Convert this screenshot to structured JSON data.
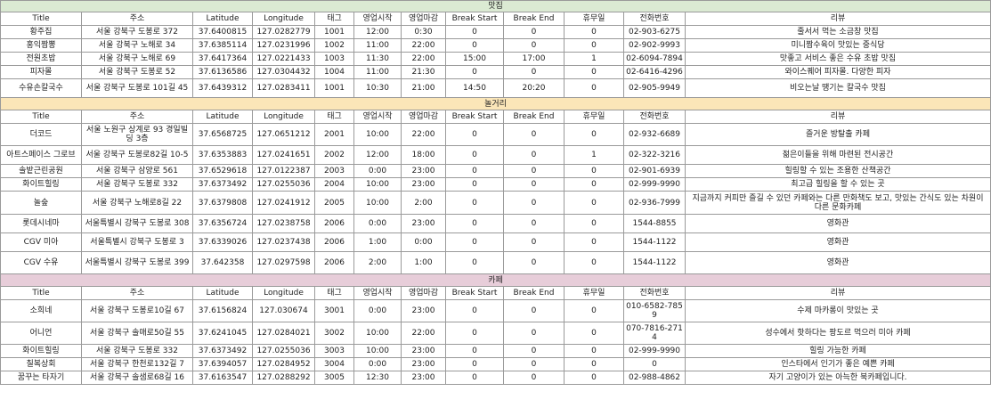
{
  "colors": {
    "section1_bg": "#dbead3",
    "section2_bg": "#fbe6b8",
    "section3_bg": "#e7cdd9",
    "grid": "#9a9a9a"
  },
  "headers": [
    "Title",
    "주소",
    "Latitude",
    "Longitude",
    "태그",
    "영업시작",
    "영업마감",
    "Break Start",
    "Break End",
    "휴무일",
    "전화번호",
    "리뷰"
  ],
  "sections": [
    {
      "title": "맛집",
      "rows": [
        [
          "황주집",
          "서울 강북구 도봉로 372",
          "37.6400815",
          "127.0282779",
          "1001",
          "12:00",
          "0:30",
          "0",
          "0",
          "0",
          "02-903-6275",
          "줄서서 먹는 소금창 맛집"
        ],
        [
          "홍익짬뽕",
          "서울 강북구 노해로 34",
          "37.6385114",
          "127.0231996",
          "1002",
          "11:00",
          "22:00",
          "0",
          "0",
          "0",
          "02-902-9993",
          "미니짬수육이 맛있는 중식당"
        ],
        [
          "전원초밥",
          "서울 강북구 노해로 69",
          "37.6417364",
          "127.0221433",
          "1003",
          "11:30",
          "22:00",
          "15:00",
          "17:00",
          "1",
          "02-6094-7894",
          "맛좋고 서비스 좋은 수유 초밥 맛집"
        ],
        [
          "피자몰",
          "서울 강북구 도봉로 52",
          "37.6136586",
          "127.0304432",
          "1004",
          "11:00",
          "21:30",
          "0",
          "0",
          "0",
          "02-6416-4296",
          "와이스퀘어 피자몰. 다양한 피자"
        ],
        [
          "수유손칼국수",
          "서울 강북구 도봉로 101길 45",
          "37.6439312",
          "127.0283411",
          "1001",
          "10:30",
          "21:00",
          "14:50",
          "20:20",
          "0",
          "02-905-9949",
          "비오는날 땡기는 칼국수 맛집"
        ]
      ]
    },
    {
      "title": "놀거리",
      "rows": [
        [
          "더코드",
          "서울 노원구 상계로 93 경일빌딩 3층",
          "37.6568725",
          "127.0651212",
          "2001",
          "10:00",
          "22:00",
          "0",
          "0",
          "0",
          "02-932-6689",
          "즐거운 방탈출 카페"
        ],
        [
          "아트스페이스 그로브",
          "서울 강북구 도봉로82길 10-5",
          "37.6353883",
          "127.0241651",
          "2002",
          "12:00",
          "18:00",
          "0",
          "0",
          "1",
          "02-322-3216",
          "젊은이들을 위해 마련된 전시공간"
        ],
        [
          "솔밭근린공원",
          "서울 강북구 삼양로 561",
          "37.6529618",
          "127.0122387",
          "2003",
          "0:00",
          "23:00",
          "0",
          "0",
          "0",
          "02-901-6939",
          "힐링할 수 있는 조용한 산책공간"
        ],
        [
          "화이트힐링",
          "서울 강북구 도봉로 332",
          "37.6373492",
          "127.0255036",
          "2004",
          "10:00",
          "23:00",
          "0",
          "0",
          "0",
          "02-999-9990",
          "최고급 힐링을 할 수 있는 곳"
        ],
        [
          "놀숲",
          "서울 강북구 노해로8길 22",
          "37.6379808",
          "127.0241912",
          "2005",
          "10:00",
          "2:00",
          "0",
          "0",
          "0",
          "02-936-7999",
          "지금까지 커피만 즐길 수 있던 카페와는 다른 만화책도 보고, 맛있는 간식도 있는 차원이 다른 문화카페"
        ],
        [
          "롯데시네마",
          "서울특별시 강북구 도봉로 308",
          "37.6356724",
          "127.0238758",
          "2006",
          "0:00",
          "23:00",
          "0",
          "0",
          "0",
          "1544-8855",
          "영화관"
        ],
        [
          "CGV 미아",
          "서울특별시 강북구 도봉로 3",
          "37.6339026",
          "127.0237438",
          "2006",
          "1:00",
          "0:00",
          "0",
          "0",
          "0",
          "1544-1122",
          "영화관"
        ],
        [
          "CGV 수유",
          "서울특별시 강북구 도봉로 399",
          "37.642358",
          "127.0297598",
          "2006",
          "2:00",
          "1:00",
          "0",
          "0",
          "0",
          "1544-1122",
          "영화관"
        ]
      ]
    },
    {
      "title": "카페",
      "rows": [
        [
          "소희네",
          "서울 강북구 도봉로10길 67",
          "37.6156824",
          "127.030674",
          "3001",
          "0:00",
          "23:00",
          "0",
          "0",
          "0",
          "010-6582-7859",
          "수제 마카롱이 맛있는 곳"
        ],
        [
          "어니언",
          "서울 강북구 솔매로50길 55",
          "37.6241045",
          "127.0284021",
          "3002",
          "10:00",
          "22:00",
          "0",
          "0",
          "0",
          "070-7816-2714",
          "성수에서 핫하다는 팡도르 먹으러 미아 카페"
        ],
        [
          "화이트힐링",
          "서울 강북구 도봉로 332",
          "37.6373492",
          "127.0255036",
          "3003",
          "10:00",
          "23:00",
          "0",
          "0",
          "0",
          "02-999-9990",
          "힐링 가능한 카페"
        ],
        [
          "칠복상회",
          "서울 강북구 한천로132길 7",
          "37.6394057",
          "127.0284952",
          "3004",
          "0:00",
          "23:00",
          "0",
          "0",
          "0",
          "0",
          "인스타에서 인기가 좋은 예쁜 카페"
        ],
        [
          "꿈꾸는 타자기",
          "서울 강북구 솔샘로68길 16",
          "37.6163547",
          "127.0288292",
          "3005",
          "12:30",
          "23:00",
          "0",
          "0",
          "0",
          "02-988-4862",
          "자기 고양이가 있는 아늑한 북카페입니다."
        ]
      ]
    }
  ]
}
